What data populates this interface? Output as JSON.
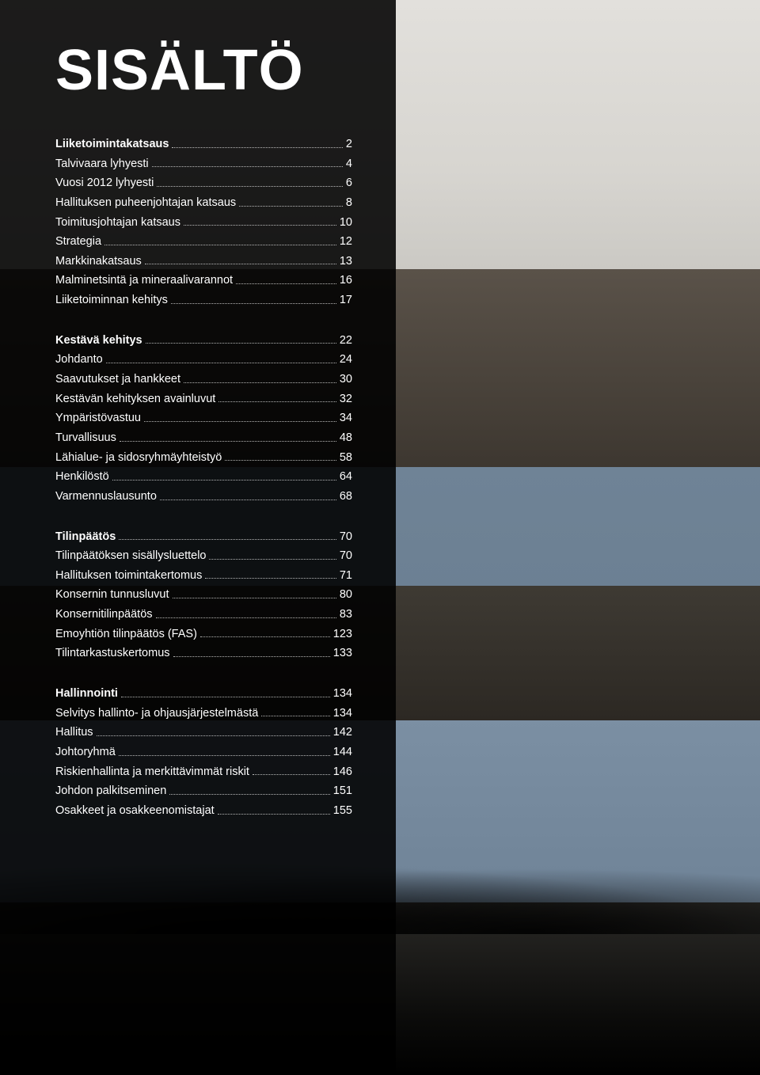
{
  "title": "SISÄLTÖ",
  "sections": [
    {
      "header": {
        "label": "Liiketoimintakatsaus",
        "page": "2"
      },
      "items": [
        {
          "label": "Talvivaara lyhyesti",
          "page": "4"
        },
        {
          "label": "Vuosi 2012 lyhyesti",
          "page": "6"
        },
        {
          "label": "Hallituksen puheenjohtajan katsaus",
          "page": "8"
        },
        {
          "label": "Toimitusjohtajan katsaus",
          "page": "10"
        },
        {
          "label": "Strategia",
          "page": "12"
        },
        {
          "label": "Markkinakatsaus",
          "page": "13"
        },
        {
          "label": "Malminetsintä ja mineraalivarannot",
          "page": "16"
        },
        {
          "label": "Liiketoiminnan kehitys",
          "page": "17"
        }
      ]
    },
    {
      "header": {
        "label": "Kestävä kehitys",
        "page": "22"
      },
      "items": [
        {
          "label": "Johdanto",
          "page": "24"
        },
        {
          "label": "Saavutukset ja hankkeet",
          "page": "30"
        },
        {
          "label": "Kestävän kehityksen avainluvut",
          "page": "32"
        },
        {
          "label": "Ympäristövastuu",
          "page": "34"
        },
        {
          "label": "Turvallisuus",
          "page": "48"
        },
        {
          "label": "Lähialue- ja sidosryhmäyhteistyö",
          "page": "58"
        },
        {
          "label": "Henkilöstö",
          "page": "64"
        },
        {
          "label": "Varmennuslausunto",
          "page": "68"
        }
      ]
    },
    {
      "header": {
        "label": "Tilinpäätös",
        "page": "70"
      },
      "items": [
        {
          "label": "Tilinpäätöksen sisällysluettelo",
          "page": "70"
        },
        {
          "label": "Hallituksen toimintakertomus",
          "page": "71"
        },
        {
          "label": "Konsernin tunnusluvut",
          "page": "80"
        },
        {
          "label": "Konsernitilinpäätös",
          "page": "83"
        },
        {
          "label": "Emoyhtiön tilinpäätös (FAS)",
          "page": "123"
        },
        {
          "label": "Tilintarkastuskertomus",
          "page": "133"
        }
      ]
    },
    {
      "header": {
        "label": "Hallinnointi",
        "page": "134"
      },
      "items": [
        {
          "label": "Selvitys hallinto- ja ohjausjärjestelmästä",
          "page": "134"
        },
        {
          "label": "Hallitus",
          "page": "142"
        },
        {
          "label": "Johtoryhmä",
          "page": "144"
        },
        {
          "label": "Riskienhallinta ja merkittävimmät riskit",
          "page": "146"
        },
        {
          "label": "Johdon palkitseminen",
          "page": "151"
        },
        {
          "label": "Osakkeet ja osakkeenomistajat",
          "page": "155"
        }
      ]
    }
  ]
}
